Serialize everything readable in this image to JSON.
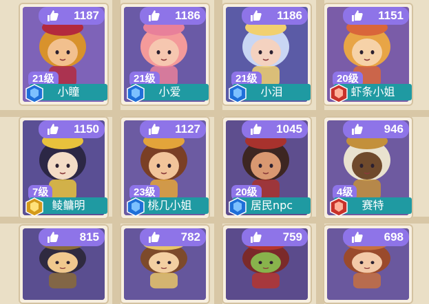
{
  "cards": [
    {
      "likes": "1187",
      "level": "21级",
      "name": "小瞳",
      "badge": "blue",
      "bg": "#7e63b8",
      "skin": "#f2c08e",
      "hair": "#d8922c",
      "hat": "#b32a3d"
    },
    {
      "likes": "1186",
      "level": "21级",
      "name": "小爱",
      "badge": "blue",
      "bg": "#6a5aa6",
      "skin": "#f6c7b0",
      "hair": "#f49a9a",
      "hat": "#e8809a"
    },
    {
      "likes": "1186",
      "level": "21级",
      "name": "小泪",
      "badge": "blue",
      "bg": "#5b5ba6",
      "skin": "#f4d2c0",
      "hair": "#c9d6f4",
      "hat": "#f1d070"
    },
    {
      "likes": "1151",
      "level": "20级",
      "name": "虾条小姐",
      "badge": "red",
      "bg": "#7a5ca8",
      "skin": "#f6d2a8",
      "hair": "#e8a546",
      "hat": "#d9663a"
    },
    {
      "likes": "1150",
      "level": "7级",
      "name": "鲮鳙明",
      "badge": "gold",
      "bg": "#5a4f94",
      "skin": "#f3dcc6",
      "hair": "#2c2745",
      "hat": "#e8c23c"
    },
    {
      "likes": "1127",
      "level": "23级",
      "name": "桃几小姐",
      "badge": "blue",
      "bg": "#6c5ba2",
      "skin": "#f2c49a",
      "hair": "#7a3f25",
      "hat": "#e3a43a"
    },
    {
      "likes": "1045",
      "level": "20级",
      "name": "居民npc",
      "badge": "blue",
      "bg": "#5e4e8e",
      "skin": "#d99871",
      "hair": "#3d2622",
      "hat": "#a8322d"
    },
    {
      "likes": "946",
      "level": "4级",
      "name": "赛特",
      "badge": "red",
      "bg": "#6e5aa0",
      "skin": "#6f4a2c",
      "hair": "#e9e2cf",
      "hat": "#c3903b"
    },
    {
      "likes": "815",
      "level": "",
      "name": "",
      "badge": "none",
      "bg": "#5a4e90",
      "skin": "#f0c88e",
      "hair": "#2f2a40",
      "hat": "#8a6b3a"
    },
    {
      "likes": "782",
      "level": "",
      "name": "",
      "badge": "none",
      "bg": "#65569c",
      "skin": "#f3cfa2",
      "hair": "#7d4a2b",
      "hat": "#e7c469"
    },
    {
      "likes": "759",
      "level": "",
      "name": "",
      "badge": "none",
      "bg": "#5b4b8c",
      "skin": "#88b34c",
      "hair": "#7b2a2a",
      "hat": "#b5352f"
    },
    {
      "likes": "698",
      "level": "",
      "name": "",
      "badge": "none",
      "bg": "#6a589e",
      "skin": "#f3c9a8",
      "hair": "#9a4a2c",
      "hat": "#c6703f"
    }
  ]
}
